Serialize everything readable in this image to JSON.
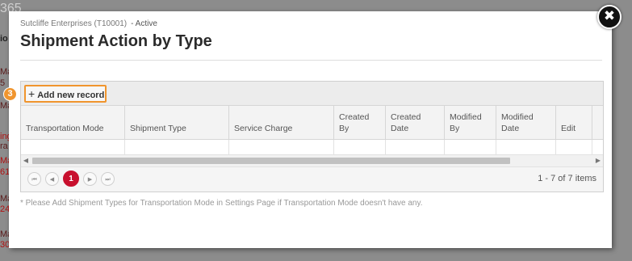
{
  "background": {
    "number": "365",
    "fragments": [
      "io",
      "Ma",
      "5",
      "Ma",
      "ing",
      "ra",
      "Ma",
      "61",
      "Ma",
      "24",
      "Ma",
      "30"
    ]
  },
  "modal": {
    "breadcrumb": {
      "company": "Sutcliffe Enterprises (T10001)",
      "status": "- Active"
    },
    "title": "Shipment Action by Type",
    "close_icon": "✖",
    "toolbar": {
      "add_label": "Add new record",
      "add_icon": "+",
      "step_badge": "3"
    },
    "columns": [
      {
        "label": "Transportation Mode"
      },
      {
        "label": "Shipment Type"
      },
      {
        "label": "Service Charge"
      },
      {
        "label": "Created By"
      },
      {
        "label": "Created Date"
      },
      {
        "label": "Modified By"
      },
      {
        "label": "Modified Date"
      },
      {
        "label": "Edit"
      }
    ],
    "pager": {
      "first": "⏮",
      "prev": "◀",
      "current_page": "1",
      "next": "▶",
      "last": "⏭",
      "info": "1 - 7 of 7 items"
    },
    "note": "* Please Add Shipment Types for Transportation Mode in Settings Page if Transportation Mode doesn't have any."
  },
  "colors": {
    "accent": "#f0952e",
    "active_page": "#c8102e"
  }
}
